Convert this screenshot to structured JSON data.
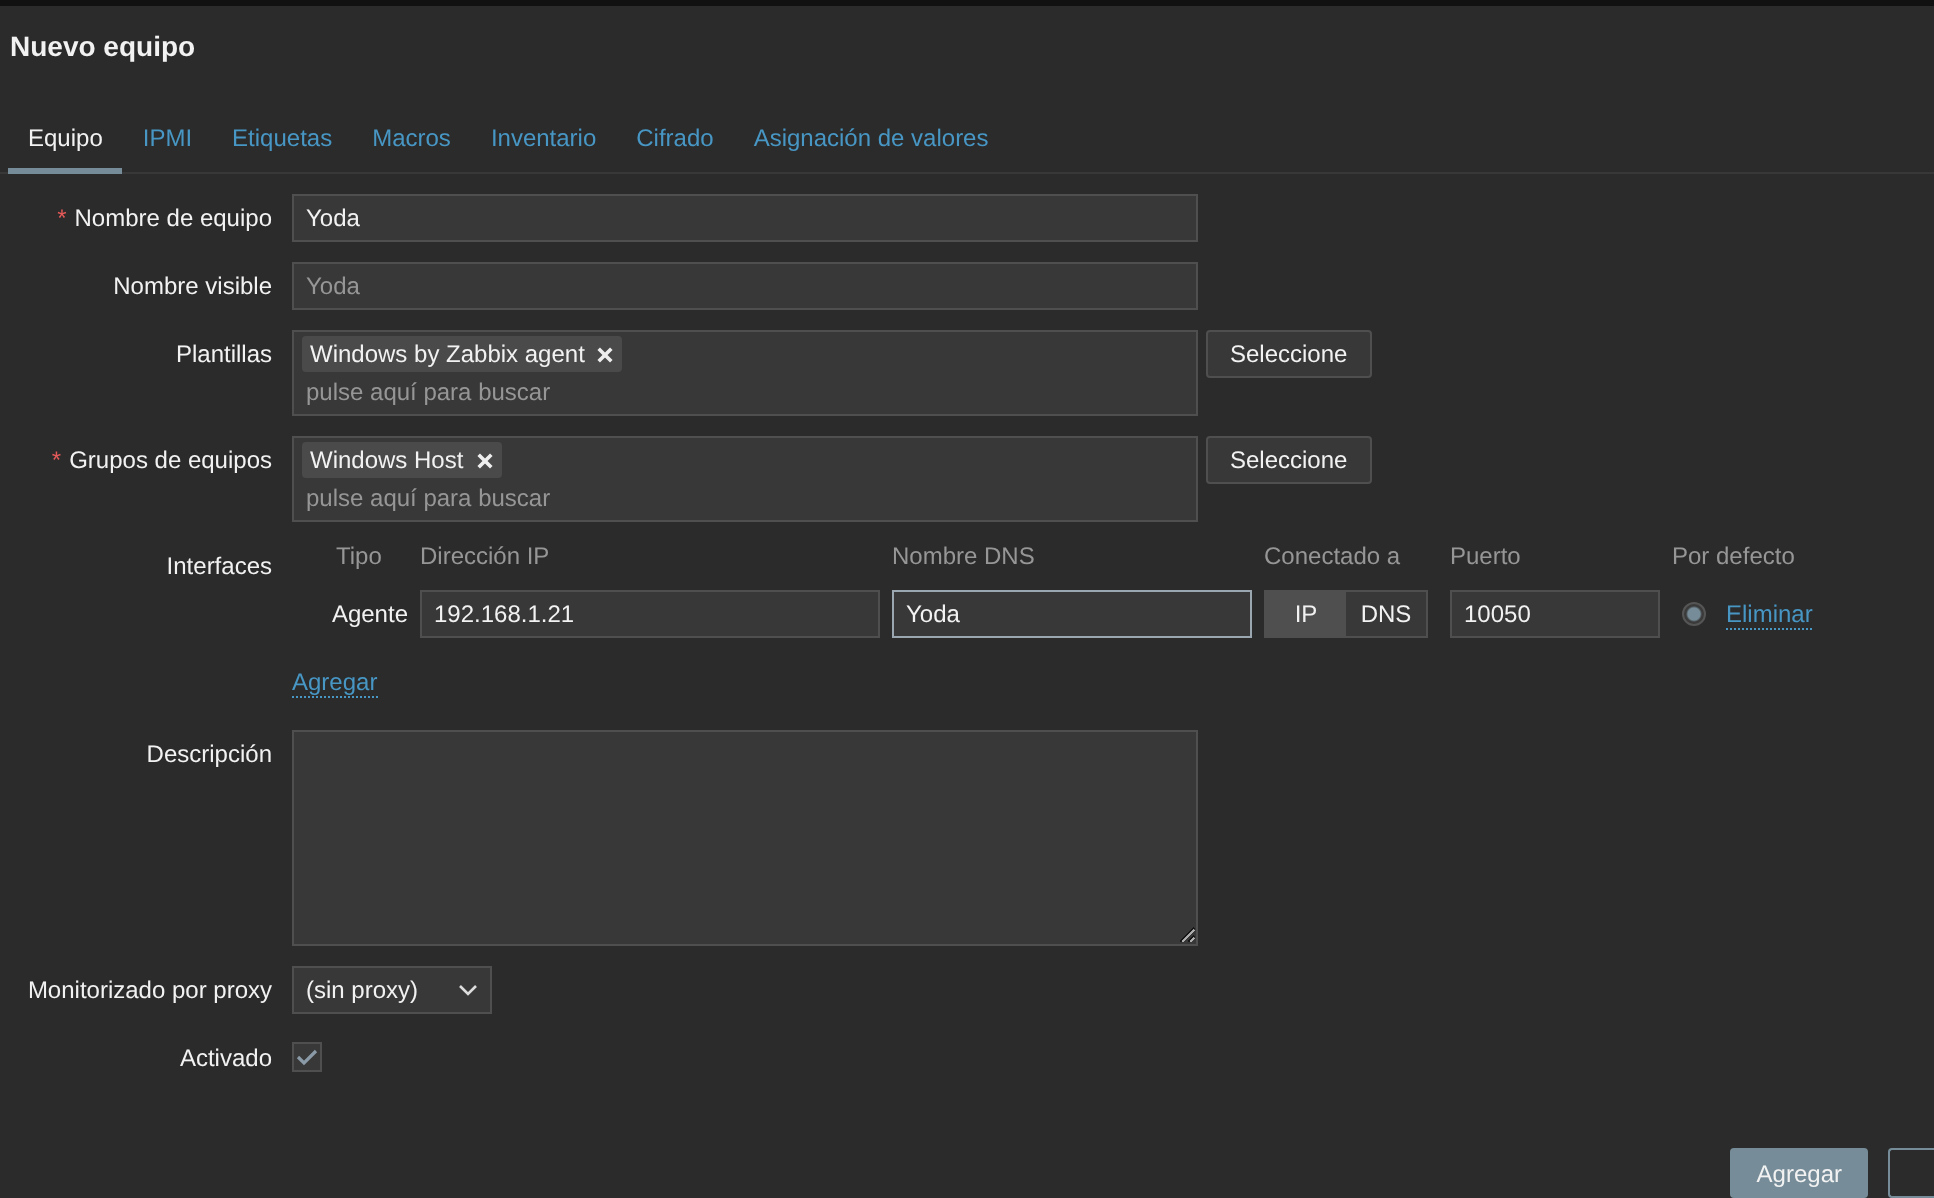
{
  "title": "Nuevo equipo",
  "tabs": [
    {
      "label": "Equipo",
      "selected": true
    },
    {
      "label": "IPMI",
      "selected": false
    },
    {
      "label": "Etiquetas",
      "selected": false
    },
    {
      "label": "Macros",
      "selected": false
    },
    {
      "label": "Inventario",
      "selected": false
    },
    {
      "label": "Cifrado",
      "selected": false
    },
    {
      "label": "Asignación de valores",
      "selected": false
    }
  ],
  "host_name": {
    "label": "Nombre de equipo",
    "required_mark": "*",
    "value": "Yoda"
  },
  "visible_name": {
    "label": "Nombre visible",
    "placeholder": "Yoda"
  },
  "templates": {
    "label": "Plantillas",
    "chips": [
      "Windows by Zabbix agent"
    ],
    "placeholder": "pulse aquí para buscar",
    "button": "Seleccione"
  },
  "host_groups": {
    "label": "Grupos de equipos",
    "required_mark": "*",
    "chips": [
      "Windows Host"
    ],
    "placeholder": "pulse aquí para buscar",
    "button": "Seleccione"
  },
  "interfaces": {
    "label": "Interfaces",
    "columns": [
      "Tipo",
      "Dirección IP",
      "Nombre DNS",
      "Conectado a",
      "Puerto",
      "Por defecto"
    ],
    "rows": [
      {
        "type": "Agente",
        "ip": "192.168.1.21",
        "dns": "Yoda",
        "dns_focused": true,
        "connect": [
          {
            "label": "IP",
            "selected": true
          },
          {
            "label": "DNS",
            "selected": false
          }
        ],
        "port": "10050",
        "default": true,
        "remove": "Eliminar"
      }
    ],
    "add": "Agregar"
  },
  "description": {
    "label": "Descripción"
  },
  "proxy": {
    "label": "Monitorizado por proxy",
    "value": "(sin proxy)"
  },
  "enabled": {
    "label": "Activado",
    "checked": true
  },
  "submit": "Agregar"
}
